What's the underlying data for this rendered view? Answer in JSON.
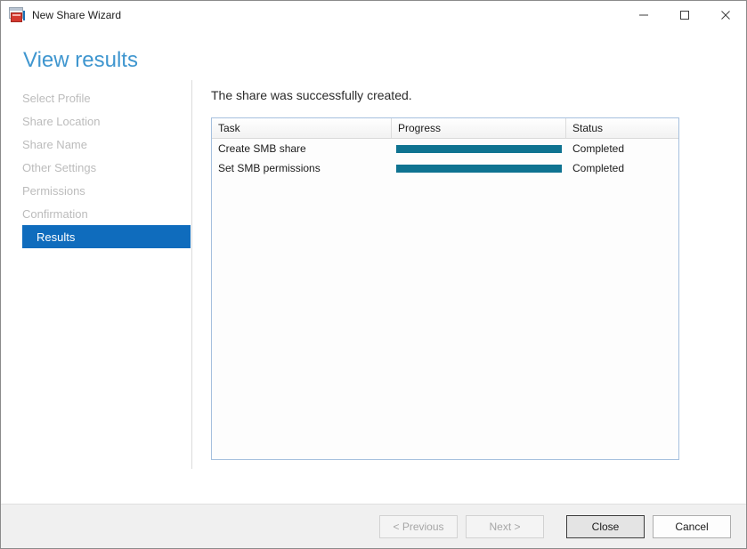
{
  "window": {
    "title": "New Share Wizard",
    "icon": "share-wizard-icon",
    "controls": {
      "minimize": "minimize-icon",
      "maximize": "maximize-icon",
      "close": "close-icon"
    }
  },
  "header": {
    "page_title": "View results",
    "title_color": "#3f96cf"
  },
  "sidebar": {
    "items": [
      {
        "label": "Select Profile",
        "active": false
      },
      {
        "label": "Share Location",
        "active": false
      },
      {
        "label": "Share Name",
        "active": false
      },
      {
        "label": "Other Settings",
        "active": false
      },
      {
        "label": "Permissions",
        "active": false
      },
      {
        "label": "Confirmation",
        "active": false
      },
      {
        "label": "Results",
        "active": true
      }
    ],
    "active_color": "#0f6cbd",
    "inactive_color": "#bcbcbc"
  },
  "content": {
    "heading": "The share was successfully created.",
    "table": {
      "columns": [
        "Task",
        "Progress",
        "Status"
      ],
      "rows": [
        {
          "task": "Create SMB share",
          "progress": 100,
          "status": "Completed"
        },
        {
          "task": "Set SMB permissions",
          "progress": 100,
          "status": "Completed"
        }
      ],
      "progress_color": "#0f7391",
      "border_color": "#a6c0de"
    }
  },
  "footer": {
    "buttons": [
      {
        "label": "< Previous",
        "state": "disabled"
      },
      {
        "label": "Next >",
        "state": "disabled"
      },
      {
        "label": "Close",
        "state": "default"
      },
      {
        "label": "Cancel",
        "state": "normal"
      }
    ]
  }
}
